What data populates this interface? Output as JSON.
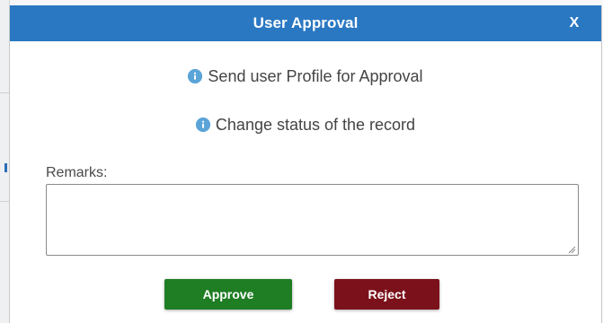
{
  "dialog": {
    "title": "User Approval",
    "close_label": "X",
    "messages": [
      "Send user Profile for Approval",
      "Change status of the record"
    ],
    "remarks": {
      "label": "Remarks:",
      "value": "",
      "placeholder": ""
    },
    "buttons": {
      "approve": "Approve",
      "reject": "Reject"
    }
  },
  "icons": {
    "info": "info-circle-icon",
    "resize": "resize-grip-icon"
  },
  "colors": {
    "titlebar": "#2a78c2",
    "approve": "#1f7d24",
    "reject": "#7b111a",
    "info": "#5aa4d8"
  }
}
